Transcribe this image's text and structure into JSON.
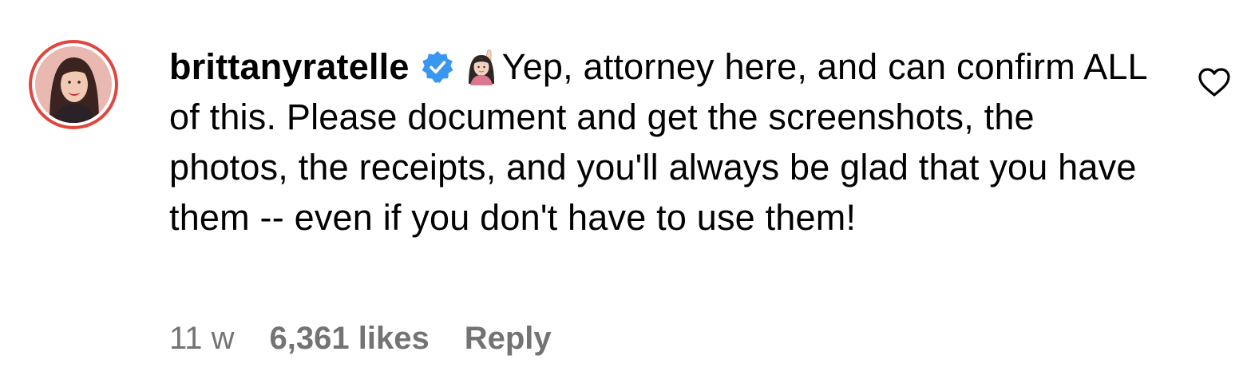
{
  "comment": {
    "username": "brittanyratelle",
    "verified": true,
    "emoji": "raising-hand-woman-emoji",
    "text": "Yep, attorney here, and can confirm ALL of this. Please document and get the screenshots, the photos, the receipts, and you'll always be glad that you have them -- even if you don't have to use them!",
    "time": "11 w",
    "likes": "6,361 likes",
    "reply_label": "Reply"
  },
  "colors": {
    "ring": "#e0463f",
    "verified": "#3897f0",
    "meta_text": "#737373",
    "text": "#000000"
  },
  "icons": {
    "like": "heart-outline-icon",
    "verified": "verified-badge-icon"
  }
}
